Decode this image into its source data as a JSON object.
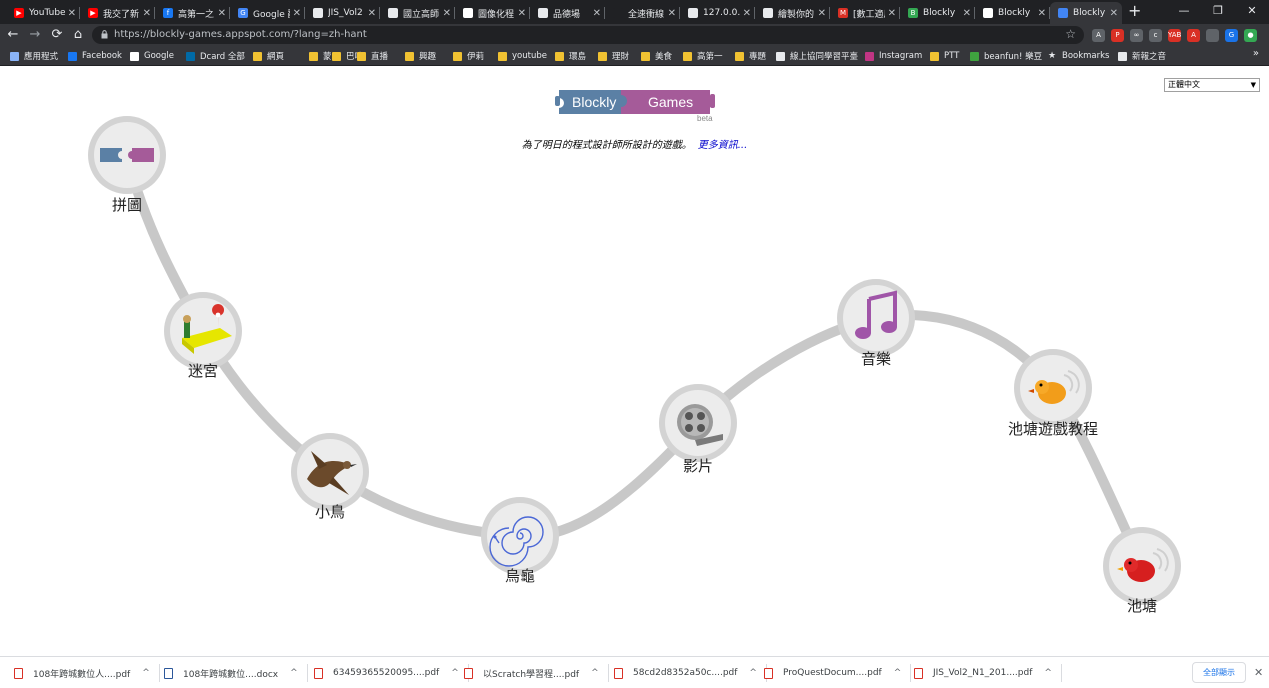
{
  "tabs": [
    {
      "title": "YouTube",
      "color": "#ff0000",
      "glyph": "▶"
    },
    {
      "title": "我交了新",
      "color": "#ff0000",
      "glyph": "▶"
    },
    {
      "title": "高第一之",
      "color": "#1877f2",
      "glyph": "f"
    },
    {
      "title": "Google 翻",
      "color": "#4285f4",
      "glyph": "G"
    },
    {
      "title": "JIS_Vol2",
      "color": "#e8eaed",
      "glyph": ""
    },
    {
      "title": "國立高師",
      "color": "#e8eaed",
      "glyph": ""
    },
    {
      "title": "圖像化程",
      "color": "#ffffff",
      "glyph": "G"
    },
    {
      "title": "品德場",
      "color": "#e8eaed",
      "glyph": ""
    },
    {
      "title": "全速衝線",
      "color": "#202124",
      "glyph": ""
    },
    {
      "title": "127.0.0.1",
      "color": "#e8eaed",
      "glyph": ""
    },
    {
      "title": "繪製你的",
      "color": "#e8eaed",
      "glyph": ""
    },
    {
      "title": "[數工適用",
      "color": "#d93025",
      "glyph": "M"
    },
    {
      "title": "Blockly",
      "color": "#34a853",
      "glyph": "B"
    },
    {
      "title": "Blockly",
      "color": "#ffffff",
      "glyph": "W"
    },
    {
      "title": "Blockly",
      "color": "#4285f4",
      "glyph": "",
      "active": true
    }
  ],
  "window_controls": [
    "—",
    "❐",
    "✕"
  ],
  "address": {
    "url": "https://blockly-games.appspot.com/?lang=zh-hant"
  },
  "extensions": [
    {
      "glyph": "A",
      "color": "#5f6368"
    },
    {
      "glyph": "P",
      "color": "#d93025"
    },
    {
      "glyph": "∞",
      "color": "#5f6368"
    },
    {
      "glyph": "c",
      "color": "#5f6368"
    },
    {
      "glyph": "YAB",
      "color": "#d93025"
    },
    {
      "glyph": "A",
      "color": "#d93025"
    },
    {
      "glyph": "",
      "color": "#5f6368"
    },
    {
      "glyph": "G",
      "color": "#1a73e8"
    },
    {
      "glyph": "●",
      "color": "#34a853"
    },
    {
      "glyph": "⋮",
      "color": "#35363a"
    }
  ],
  "bookmarks": [
    {
      "label": "應用程式",
      "type": "apps"
    },
    {
      "label": "Facebook",
      "type": "facebook"
    },
    {
      "label": "Google",
      "type": "google"
    },
    {
      "label": "Dcard 全部",
      "type": "dcard"
    },
    {
      "label": "網頁",
      "type": "folder"
    },
    {
      "label": "蒙",
      "type": "folder"
    },
    {
      "label": "巴哈",
      "type": "folder"
    },
    {
      "label": "直播",
      "type": "folder"
    },
    {
      "label": "興趣",
      "type": "folder"
    },
    {
      "label": "伊莉",
      "type": "folder"
    },
    {
      "label": "youtube",
      "type": "folder"
    },
    {
      "label": "環島",
      "type": "folder"
    },
    {
      "label": "理財",
      "type": "folder"
    },
    {
      "label": "美食",
      "type": "folder"
    },
    {
      "label": "高第一",
      "type": "folder"
    },
    {
      "label": "專題",
      "type": "folder"
    },
    {
      "label": "線上協同學習平臺",
      "type": "site"
    },
    {
      "label": "Instagram",
      "type": "instagram"
    },
    {
      "label": "PTT",
      "type": "folder"
    },
    {
      "label": "beanfun! 樂豆",
      "type": "beanfun"
    },
    {
      "label": "Bookmarks",
      "type": "star"
    },
    {
      "label": "新報之音",
      "type": "page"
    }
  ],
  "bookmarks_more": "»",
  "page": {
    "language": "正體中文",
    "logo_left": "Blockly",
    "logo_right": "Games",
    "beta": "beta",
    "tagline": "為了明日的程式設計師所設計的遊戲。",
    "more_info": "更多資訊...",
    "games": [
      {
        "label": "拼圖",
        "icon": "puzzle-icon"
      },
      {
        "label": "迷宮",
        "icon": "maze-icon"
      },
      {
        "label": "小鳥",
        "icon": "bird-icon"
      },
      {
        "label": "烏龜",
        "icon": "turtle-icon"
      },
      {
        "label": "影片",
        "icon": "movie-reel-icon"
      },
      {
        "label": "音樂",
        "icon": "music-note-icon"
      },
      {
        "label": "池塘遊戲教程",
        "icon": "pond-tutor-duck-icon"
      },
      {
        "label": "池塘",
        "icon": "pond-duck-icon"
      }
    ],
    "colors": {
      "blue_block": "#5b80a5",
      "purple_block": "#a55b99",
      "path": "#c8c8c8"
    }
  },
  "downloads": [
    {
      "name": "108年跨城數位人....pdf",
      "type": "pdf"
    },
    {
      "name": "108年跨城數位....docx",
      "type": "docx"
    },
    {
      "name": "63459365520095....pdf",
      "type": "pdf"
    },
    {
      "name": "以Scratch學習程....pdf",
      "type": "pdf"
    },
    {
      "name": "58cd2d8352a50c....pdf",
      "type": "pdf"
    },
    {
      "name": "ProQuestDocum....pdf",
      "type": "pdf"
    },
    {
      "name": "JIS_Vol2_N1_201....pdf",
      "type": "pdf"
    }
  ],
  "show_all": "全部顯示"
}
